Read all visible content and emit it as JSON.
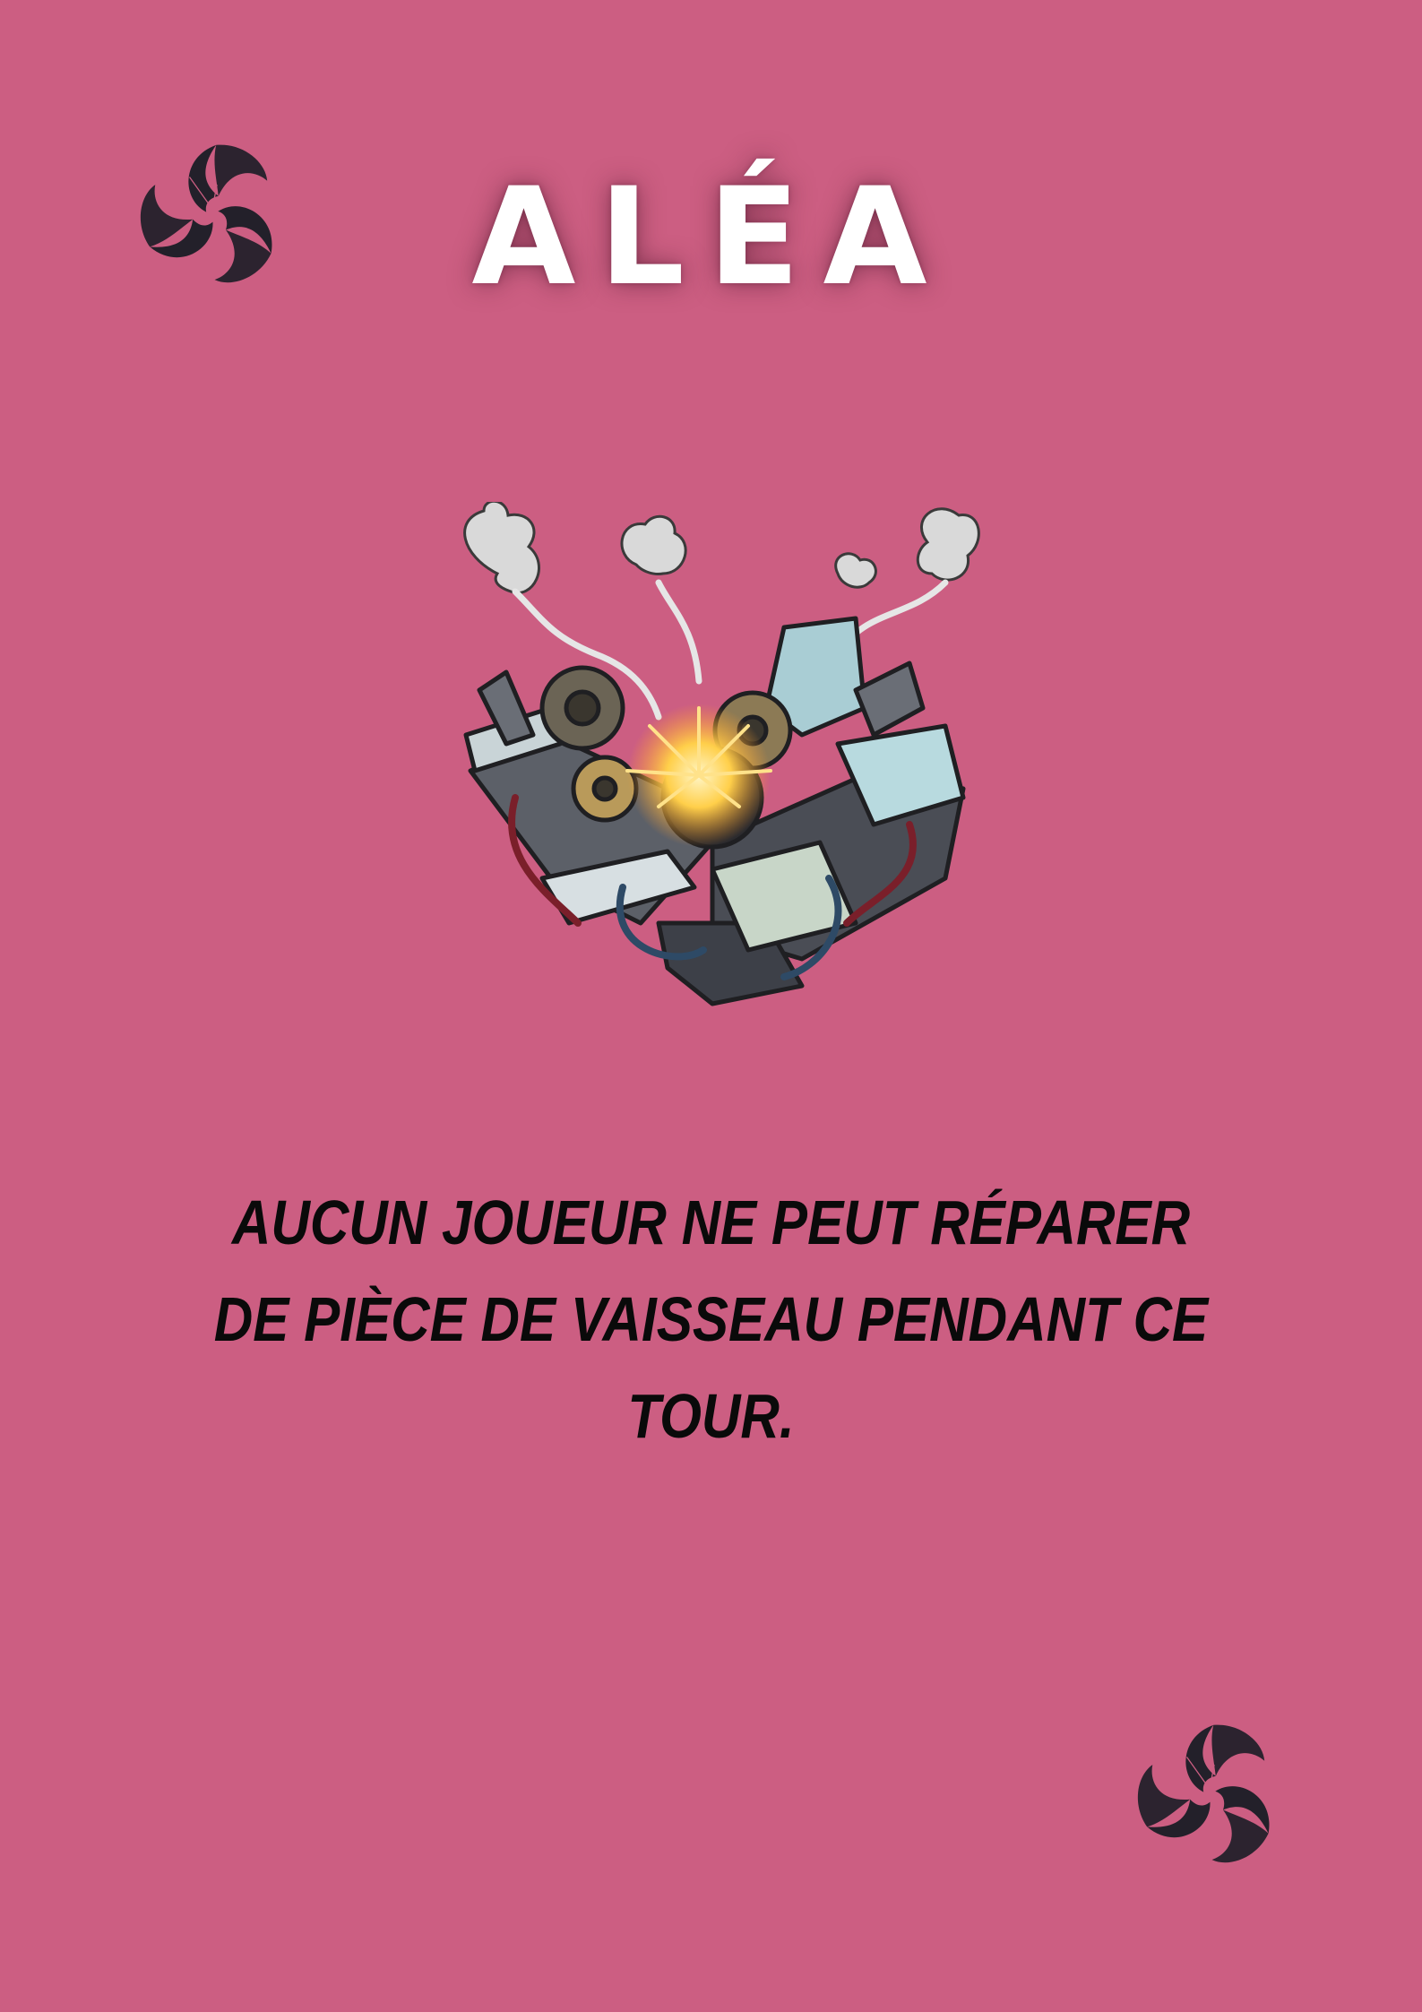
{
  "card": {
    "title": "ALÉA",
    "text": "AUCUN JOUEUR NE PEUT RÉPARER DE PIÈCE DE VAISSEAU PENDANT CE TOUR.",
    "illustration_icon": "broken-machinery-explosion-icon",
    "emblem_icon": "spiral-leaf-emblem-icon"
  },
  "colors": {
    "background": "#cc5e82",
    "title": "#ffffff",
    "text": "#0a0a0a",
    "emblem": "#23202a"
  }
}
